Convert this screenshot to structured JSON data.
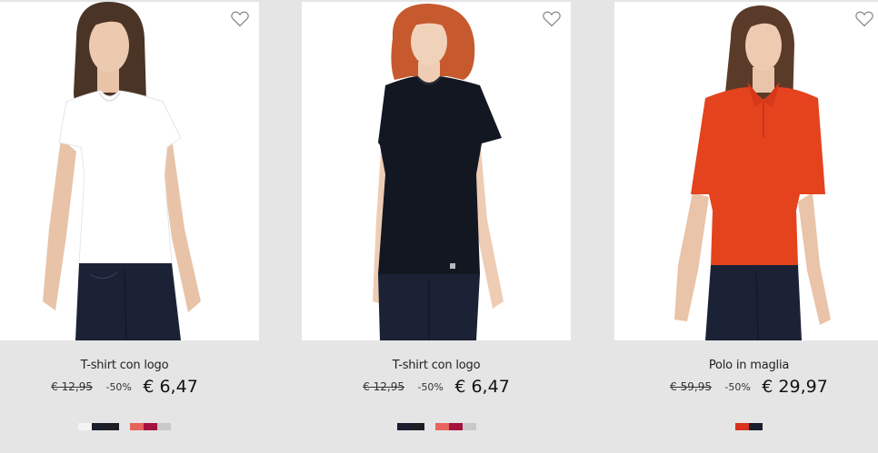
{
  "products": [
    {
      "title": "T-shirt con logo",
      "old_price": "€ 12,95",
      "discount": "-50%",
      "price": "€ 6,47",
      "swatch_groups": [
        [
          "#f3f3f3",
          "#1b1e2e",
          "#1d1d22"
        ],
        [
          "#e7645d",
          "#a4123e",
          "#c9c9cc"
        ]
      ],
      "garment_color": "#ffffff",
      "hair_color": "#4a3426"
    },
    {
      "title": "T-shirt con logo",
      "old_price": "€ 12,95",
      "discount": "-50%",
      "price": "€ 6,47",
      "swatch_groups": [
        [
          "#1b1e2e",
          "#1d1d22"
        ],
        [
          "#e7645d",
          "#a4123e",
          "#c9c9cc"
        ]
      ],
      "garment_color": "#121722",
      "hair_color": "#c65a2e"
    },
    {
      "title": "Polo in maglia",
      "old_price": "€ 59,95",
      "discount": "-50%",
      "price": "€ 29,97",
      "swatch_groups": [
        [
          "#d8311c",
          "#1b1e2e"
        ]
      ],
      "garment_color": "#e5421e",
      "hair_color": "#5a3a28"
    }
  ],
  "icons": {
    "wishlist": "heart-outline-icon"
  }
}
